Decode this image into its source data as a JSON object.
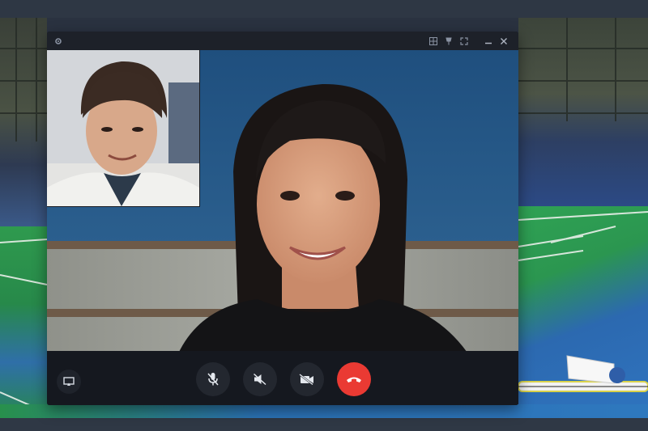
{
  "window": {
    "titlebar_icons": [
      "gear-icon",
      "layout-grid-icon",
      "pin-icon",
      "fullscreen-icon",
      "minimize-icon",
      "close-icon"
    ]
  },
  "controls": {
    "share_screen": {
      "icon": "screen-share-icon"
    },
    "mute_mic": {
      "icon": "mic-off-icon",
      "state": "muted"
    },
    "speaker": {
      "icon": "speaker-off-icon",
      "state": "muted"
    },
    "camera": {
      "icon": "video-off-icon",
      "state": "off"
    },
    "hangup": {
      "icon": "hangup-icon",
      "color": "#ea3a33"
    }
  },
  "colors": {
    "window_bg": "#15181f",
    "titlebar_bg": "#1d2129",
    "control_btn_bg": "#23272f",
    "hangup_red": "#ea3a33",
    "main_video_backdrop": "#21456f"
  }
}
